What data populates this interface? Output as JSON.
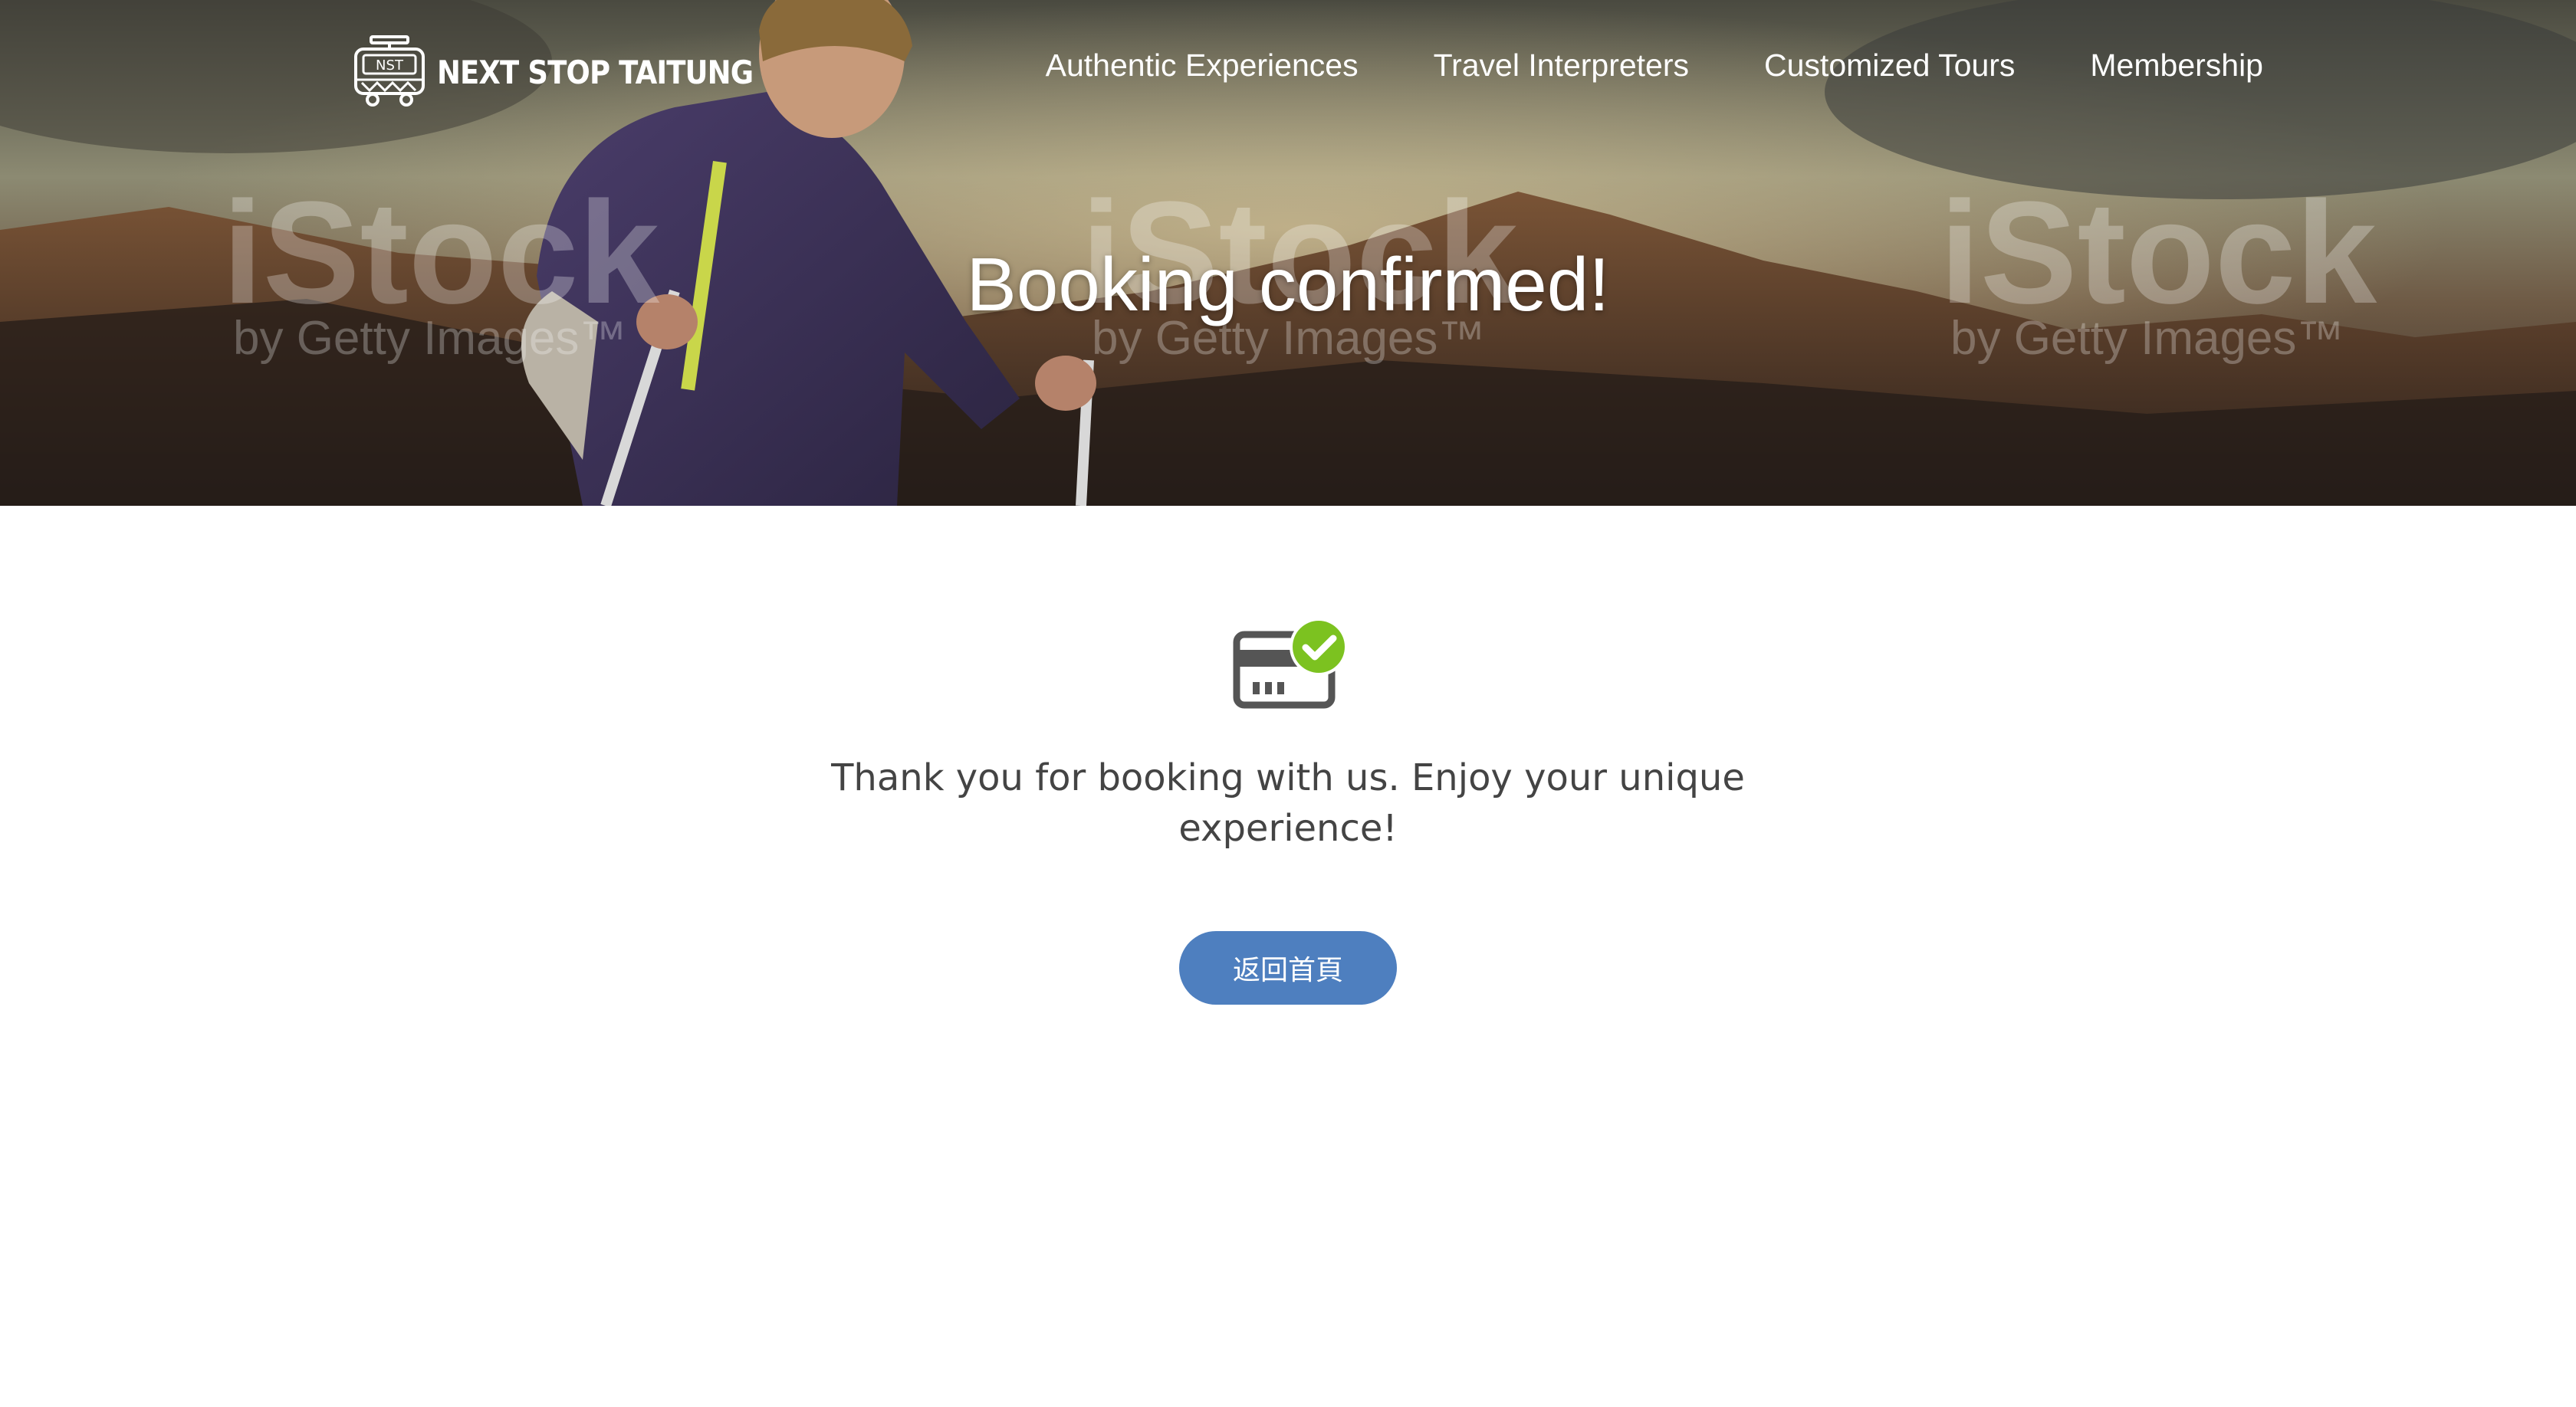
{
  "header": {
    "logo_mark": "NST",
    "logo_text": "NEXT STOP TAITUNG",
    "nav": [
      {
        "label": "Authentic Experiences"
      },
      {
        "label": "Travel Interpreters"
      },
      {
        "label": "Customized Tours"
      },
      {
        "label": "Membership"
      }
    ]
  },
  "hero": {
    "title": "Booking confirmed!",
    "watermark_line1": "iStock",
    "watermark_line2": "by Getty Images"
  },
  "main": {
    "icon": "payment-card-check-icon",
    "message": "Thank you for booking with us. Enjoy your unique experience!",
    "home_button_label": "返回首頁"
  },
  "colors": {
    "button": "#4e7fbf",
    "check": "#7cc220",
    "card_icon": "#555555",
    "message_text": "#444444"
  }
}
